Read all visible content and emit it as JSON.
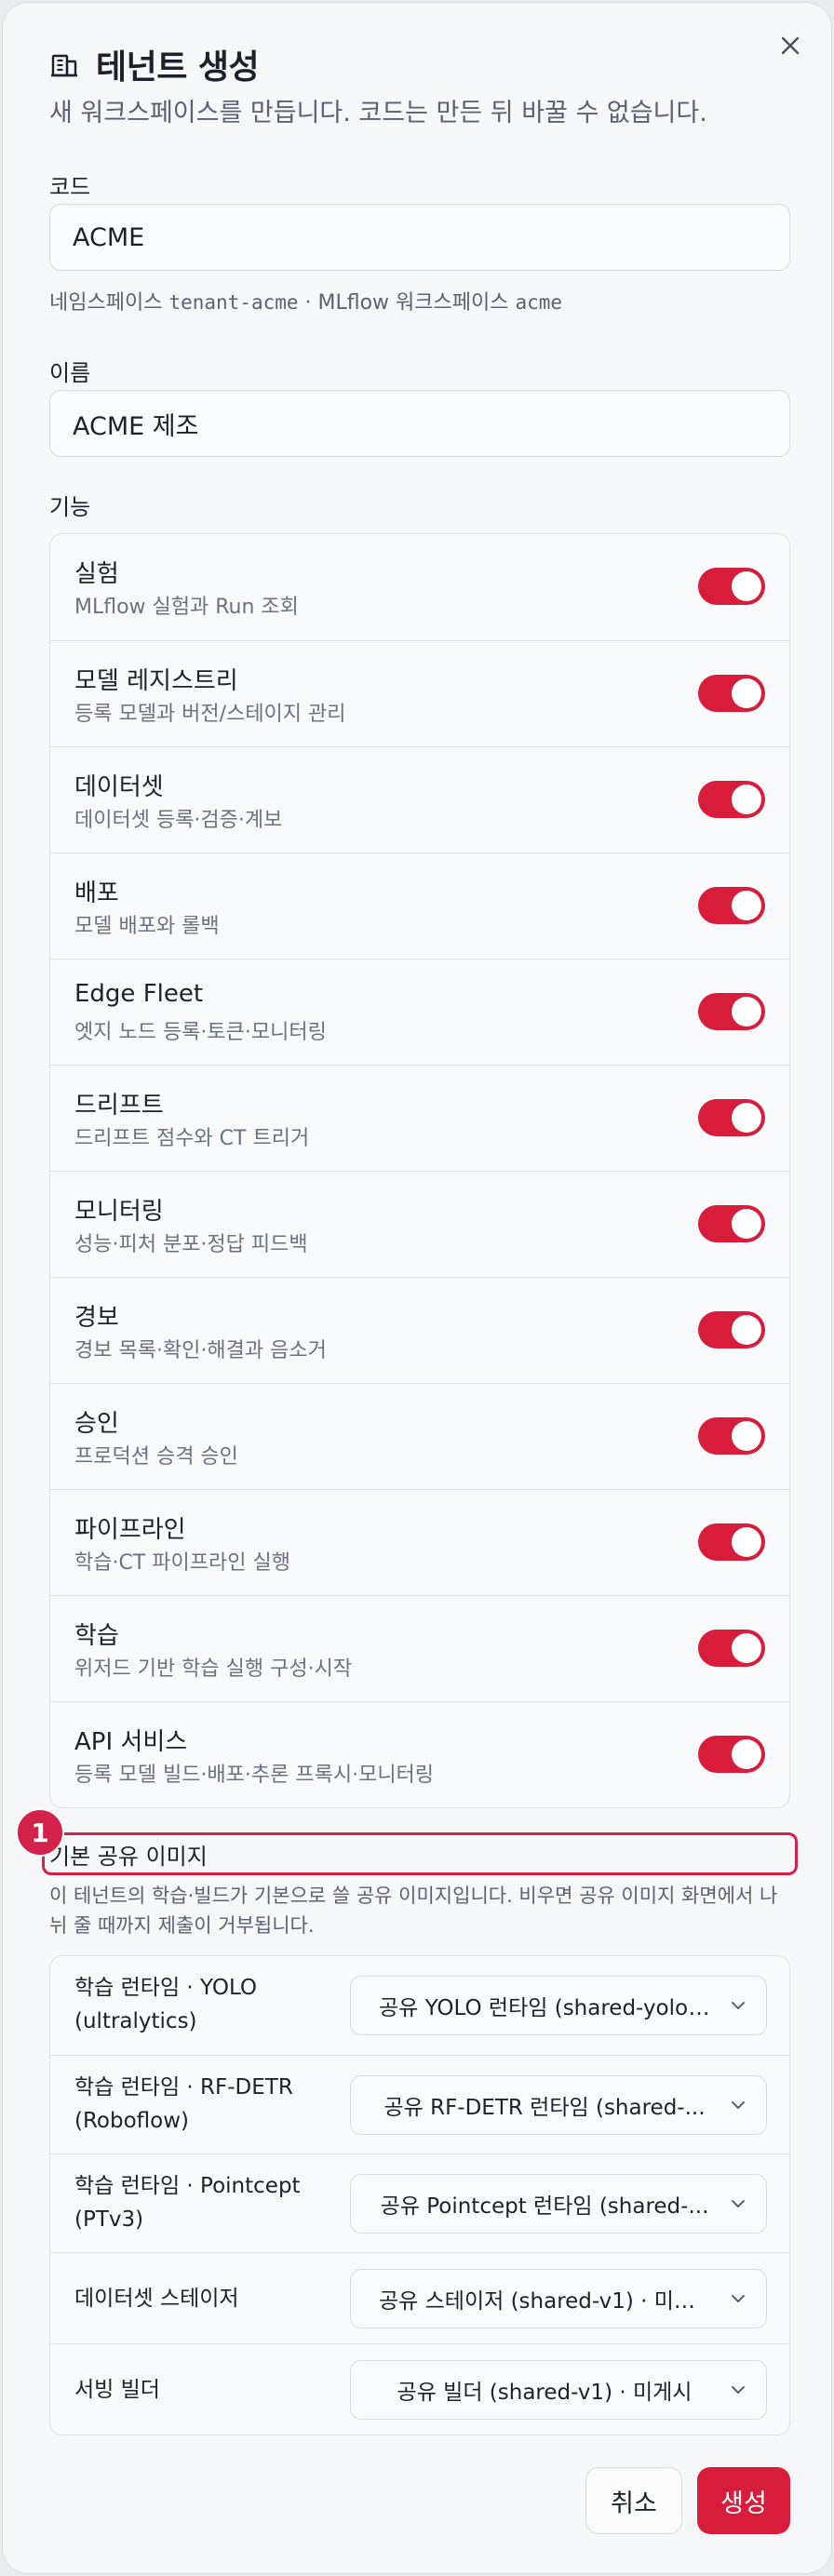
{
  "dialog": {
    "title": "테넌트 생성",
    "subtitle": "새 워크스페이스를 만듭니다. 코드는 만든 뒤 바꿀 수 없습니다."
  },
  "code": {
    "label": "코드",
    "value": "ACME",
    "hint_prefix": "네임스페이스 ",
    "hint_namespace": "tenant-acme",
    "hint_middle": " · MLflow 워크스페이스 ",
    "hint_workspace": "acme"
  },
  "name": {
    "label": "이름",
    "value": "ACME 제조"
  },
  "features": {
    "label": "기능",
    "items": [
      {
        "name": "실험",
        "desc": "MLflow 실험과 Run 조회",
        "enabled": true
      },
      {
        "name": "모델 레지스트리",
        "desc": "등록 모델과 버전/스테이지 관리",
        "enabled": true
      },
      {
        "name": "데이터셋",
        "desc": "데이터셋 등록·검증·계보",
        "enabled": true
      },
      {
        "name": "배포",
        "desc": "모델 배포와 롤백",
        "enabled": true
      },
      {
        "name": "Edge Fleet",
        "desc": "엣지 노드 등록·토큰·모니터링",
        "enabled": true
      },
      {
        "name": "드리프트",
        "desc": "드리프트 점수와 CT 트리거",
        "enabled": true
      },
      {
        "name": "모니터링",
        "desc": "성능·피처 분포·정답 피드백",
        "enabled": true
      },
      {
        "name": "경보",
        "desc": "경보 목록·확인·해결과 음소거",
        "enabled": true
      },
      {
        "name": "승인",
        "desc": "프로덕션 승격 승인",
        "enabled": true
      },
      {
        "name": "파이프라인",
        "desc": "학습·CT 파이프라인 실행",
        "enabled": true
      },
      {
        "name": "학습",
        "desc": "위저드 기반 학습 실행 구성·시작",
        "enabled": true
      },
      {
        "name": "API 서비스",
        "desc": "등록 모델 빌드·배포·추론 프록시·모니터링",
        "enabled": true
      }
    ]
  },
  "annotation": {
    "badge": "1"
  },
  "shared_images": {
    "title": "기본 공유 이미지",
    "desc": "이 테넌트의 학습·빌드가 기본으로 쓸 공유 이미지입니다. 비우면 공유 이미지 화면에서 나뉘 줄 때까지 제출이 거부됩니다.",
    "items": [
      {
        "label": "학습 런타임 · YOLO (ultralytics)",
        "value": "공유 YOLO 런타임 (shared-yolo-..."
      },
      {
        "label": "학습 런타임 · RF-DETR (Roboflow)",
        "value": "공유 RF-DETR 런타임 (shared-..."
      },
      {
        "label": "학습 런타임 · Pointcept (PTv3)",
        "value": "공유 Pointcept 런타임 (shared-..."
      },
      {
        "label": "데이터셋 스테이저",
        "value": "공유 스테이저 (shared-v1) · 미게시"
      },
      {
        "label": "서빙 빌더",
        "value": "공유 빌더 (shared-v1) · 미게시"
      }
    ]
  },
  "buttons": {
    "cancel": "취소",
    "create": "생성"
  },
  "colors": {
    "accent": "#d71c3c",
    "annotation": "#d3214a"
  }
}
